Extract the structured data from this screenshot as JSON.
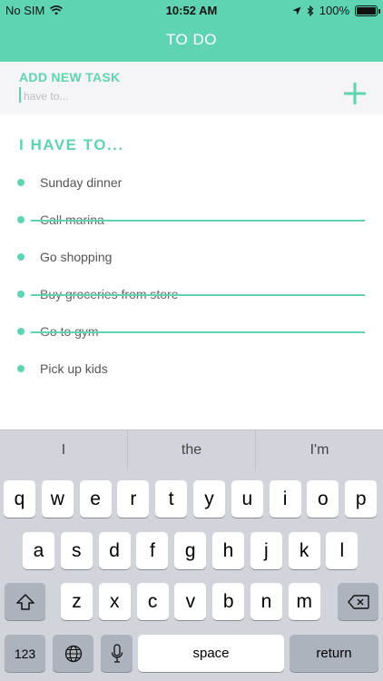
{
  "status_bar": {
    "carrier": "No SIM",
    "time": "10:52 AM",
    "battery": "100%"
  },
  "header": {
    "title": "TO DO"
  },
  "add_task": {
    "label": "ADD NEW TASK",
    "placeholder": "have to...",
    "value": ""
  },
  "list": {
    "title": "I HAVE TO...",
    "items": [
      {
        "text": "Sunday dinner",
        "done": false
      },
      {
        "text": "Call marina",
        "done": true
      },
      {
        "text": "Go shopping",
        "done": false
      },
      {
        "text": "Buy groceries from store",
        "done": true
      },
      {
        "text": "Go to gym",
        "done": true
      },
      {
        "text": "Pick up kids",
        "done": false
      }
    ]
  },
  "keyboard": {
    "suggestions": [
      "I",
      "the",
      "I'm"
    ],
    "row1": [
      "q",
      "w",
      "e",
      "r",
      "t",
      "y",
      "u",
      "i",
      "o",
      "p"
    ],
    "row2": [
      "a",
      "s",
      "d",
      "f",
      "g",
      "h",
      "j",
      "k",
      "l"
    ],
    "row3": [
      "z",
      "x",
      "c",
      "v",
      "b",
      "n",
      "m"
    ],
    "numbers_label": "123",
    "space_label": "space",
    "return_label": "return",
    "icons": [
      "shift-icon",
      "backspace-icon",
      "globe-icon",
      "microphone-icon"
    ]
  },
  "colors": {
    "accent": "#5fd4b3",
    "panel": "#f5f5f7",
    "keyboard_bg": "#d1d5db"
  }
}
